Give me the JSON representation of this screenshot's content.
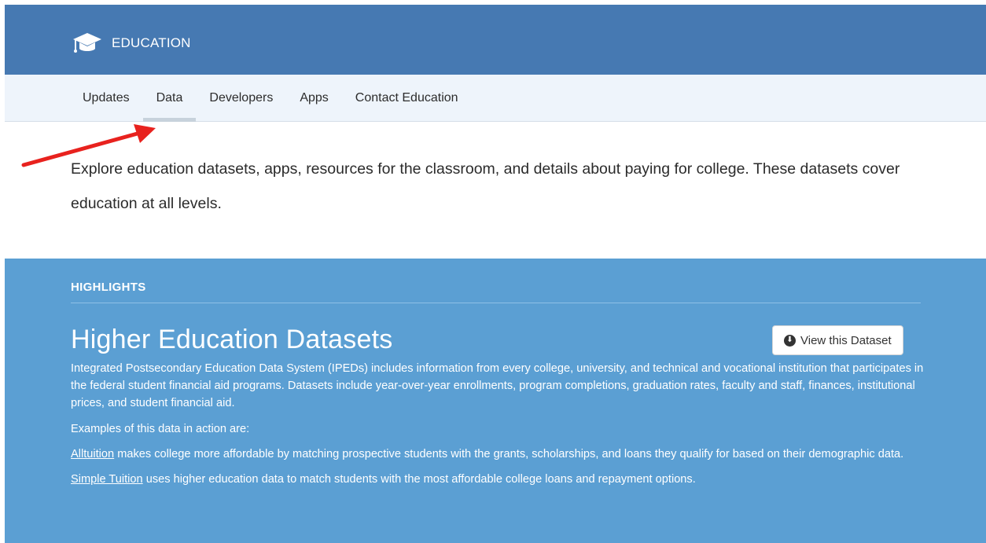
{
  "header": {
    "brand_icon": "graduation-cap-icon",
    "title": "EDUCATION",
    "background_color": "#4679b2"
  },
  "subnav": {
    "items": [
      {
        "label": "Updates"
      },
      {
        "label": "Data",
        "active": true
      },
      {
        "label": "Developers"
      },
      {
        "label": "Apps"
      },
      {
        "label": "Contact Education"
      }
    ]
  },
  "annotation": {
    "arrow_color": "#e8221e"
  },
  "intro": {
    "text": "Explore education datasets, apps, resources for the classroom, and details about paying for college. These datasets cover education at all levels."
  },
  "highlights": {
    "label": "HIGHLIGHTS",
    "background_color": "#5b9fd3",
    "title": "Higher Education Datasets",
    "view_button": {
      "icon": "download-circle-icon",
      "label": "View this Dataset"
    },
    "description": "Integrated Postsecondary Education Data System (IPEDs) includes information from every college, university, and technical and vocational institution that participates in the federal student financial aid programs. Datasets include year-over-year enrollments, program completions, graduation rates, faculty and staff, finances, institutional prices, and student financial aid.",
    "examples_intro": "Examples of this data in action are:",
    "examples": [
      {
        "link": "Alltuition",
        "text": " makes college more affordable by matching prospective students with the grants, scholarships, and loans they qualify for based on their demographic data."
      },
      {
        "link": "Simple Tuition",
        "text": " uses higher education data to match students with the most affordable college loans and repayment options."
      }
    ]
  }
}
